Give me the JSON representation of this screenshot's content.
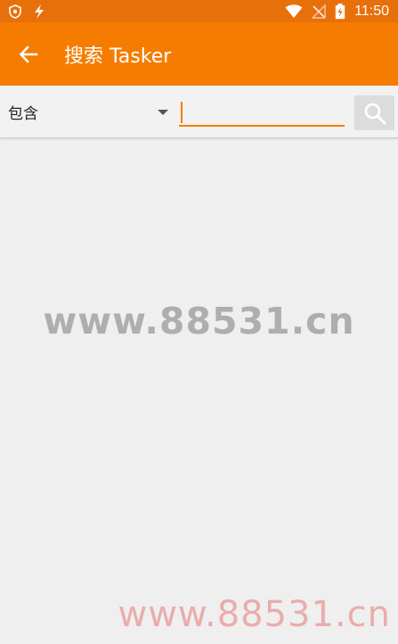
{
  "status_bar": {
    "time": "11:50",
    "icons_left": [
      "shield-notification-icon",
      "lightning-notification-icon"
    ],
    "icons_right": [
      "wifi-icon",
      "no-signal-icon",
      "battery-charging-icon"
    ]
  },
  "app_bar": {
    "title": "搜索 Tasker",
    "back_icon": "arrow-back-icon",
    "color": "#f57c00"
  },
  "search": {
    "match_mode": "包含",
    "query": "",
    "placeholder": "",
    "button_icon": "search-icon",
    "accent": "#f57c00"
  },
  "watermarks": {
    "center": "www.88531.cn",
    "bottom": "www.88531.cn"
  }
}
